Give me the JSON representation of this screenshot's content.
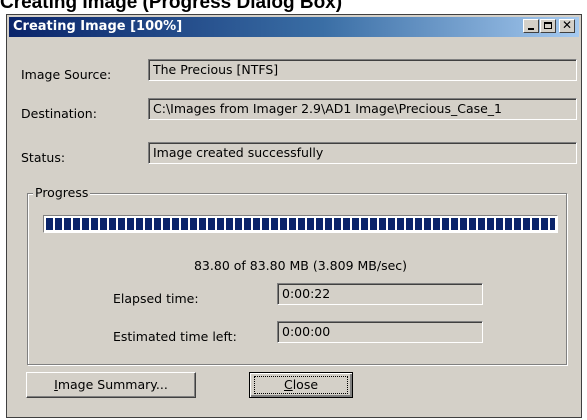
{
  "caption": "Creating Image (Progress Dialog Box)",
  "window": {
    "title": "Creating Image [100%]",
    "controls": {
      "minimize": "minimize-icon",
      "maximize": "maximize-icon",
      "close": "close-icon"
    }
  },
  "fields": {
    "source_label": "Image Source:",
    "source_value": "The Precious [NTFS]",
    "destination_label": "Destination:",
    "destination_value": "C:\\Images from Imager 2.9\\AD1 Image\\Precious_Case_1",
    "status_label": "Status:",
    "status_value": "Image created successfully"
  },
  "progress": {
    "group_title": "Progress",
    "percent": 100,
    "summary": "83.80 of 83.80 MB (3.809 MB/sec)",
    "elapsed_label": "Elapsed time:",
    "elapsed_value": "0:00:22",
    "remaining_label": "Estimated time left:",
    "remaining_value": "0:00:00"
  },
  "buttons": {
    "summary_first": "I",
    "summary_rest": "mage Summary...",
    "close_first": "C",
    "close_rest": "lose"
  },
  "colors": {
    "titlebar": "#0a246a",
    "progress": "#0a246a",
    "face": "#d4d0c8"
  }
}
